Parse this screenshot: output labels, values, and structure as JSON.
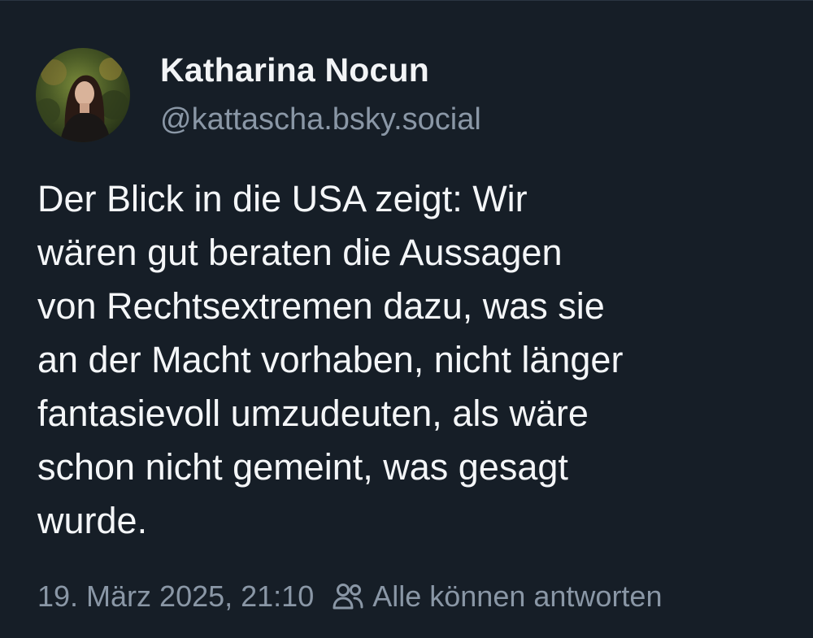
{
  "author": {
    "display_name": "Katharina Nocun",
    "handle": "@kattascha.bsky.social"
  },
  "post": {
    "text": "Der Blick in die USA zeigt: Wir\nwären gut beraten die Aussagen\nvon Rechtsextremen dazu, was sie\nan der Macht vorhaben, nicht länger\nfantasievoll umzudeuten, als wäre\nschon nicht gemeint, was gesagt\nwurde."
  },
  "meta": {
    "timestamp": "19. März 2025, 21:10",
    "reply_permission": "Alle können antworten",
    "reply_icon": "people-icon"
  },
  "colors": {
    "background": "#161e27",
    "text_primary": "#f4f6f8",
    "text_secondary": "#8a97a6"
  }
}
